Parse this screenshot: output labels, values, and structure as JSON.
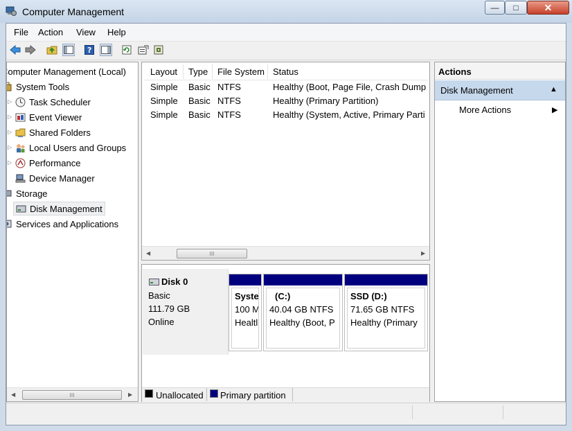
{
  "window": {
    "title": "Computer Management",
    "minimize": "—",
    "maximize": "□",
    "close": "✕"
  },
  "menu": [
    "File",
    "Action",
    "View",
    "Help"
  ],
  "tree": {
    "root": "Computer Management (Local)",
    "items": [
      {
        "label": "System Tools",
        "icon": "toolbox-icon"
      },
      {
        "label": "Task Scheduler",
        "icon": "clock-icon"
      },
      {
        "label": "Event Viewer",
        "icon": "event-viewer-icon"
      },
      {
        "label": "Shared Folders",
        "icon": "shared-folder-icon"
      },
      {
        "label": "Local Users and Groups",
        "icon": "users-icon"
      },
      {
        "label": "Performance",
        "icon": "performance-icon"
      },
      {
        "label": "Device Manager",
        "icon": "device-manager-icon"
      },
      {
        "label": "Storage",
        "icon": "storage-icon"
      },
      {
        "label": "Disk Management",
        "icon": "disk-icon"
      },
      {
        "label": "Services and Applications",
        "icon": "services-icon"
      }
    ],
    "scroll_grip": "III"
  },
  "volume_list": {
    "columns": [
      "Layout",
      "Type",
      "File System",
      "Status"
    ],
    "rows": [
      {
        "layout": "Simple",
        "type": "Basic",
        "fs": "NTFS",
        "status": "Healthy (Boot, Page File, Crash Dump"
      },
      {
        "layout": "Simple",
        "type": "Basic",
        "fs": "NTFS",
        "status": "Healthy (Primary Partition)"
      },
      {
        "layout": "Simple",
        "type": "Basic",
        "fs": "NTFS",
        "status": "Healthy (System, Active, Primary Parti"
      }
    ],
    "scroll_grip": "III"
  },
  "disk": {
    "name": "Disk 0",
    "type": "Basic",
    "size": "111.79 GB",
    "state": "Online",
    "partitions": [
      {
        "title": "Syste",
        "size": "100 M",
        "status": "Healtl"
      },
      {
        "title": "(C:)",
        "size": "40.04 GB NTFS",
        "status": "Healthy (Boot, P"
      },
      {
        "title": "SSD  (D:)",
        "size": "71.65 GB NTFS",
        "status": "Healthy (Primary"
      }
    ]
  },
  "legend": [
    {
      "label": "Unallocated",
      "color": "#000000"
    },
    {
      "label": "Primary partition",
      "color": "#00007f"
    }
  ],
  "actions": {
    "header": "Actions",
    "section": "Disk Management",
    "items": [
      "More Actions"
    ]
  },
  "colors": {
    "primary_partition": "#00007f",
    "unallocated": "#000000",
    "selection": "#c6d8ec"
  }
}
